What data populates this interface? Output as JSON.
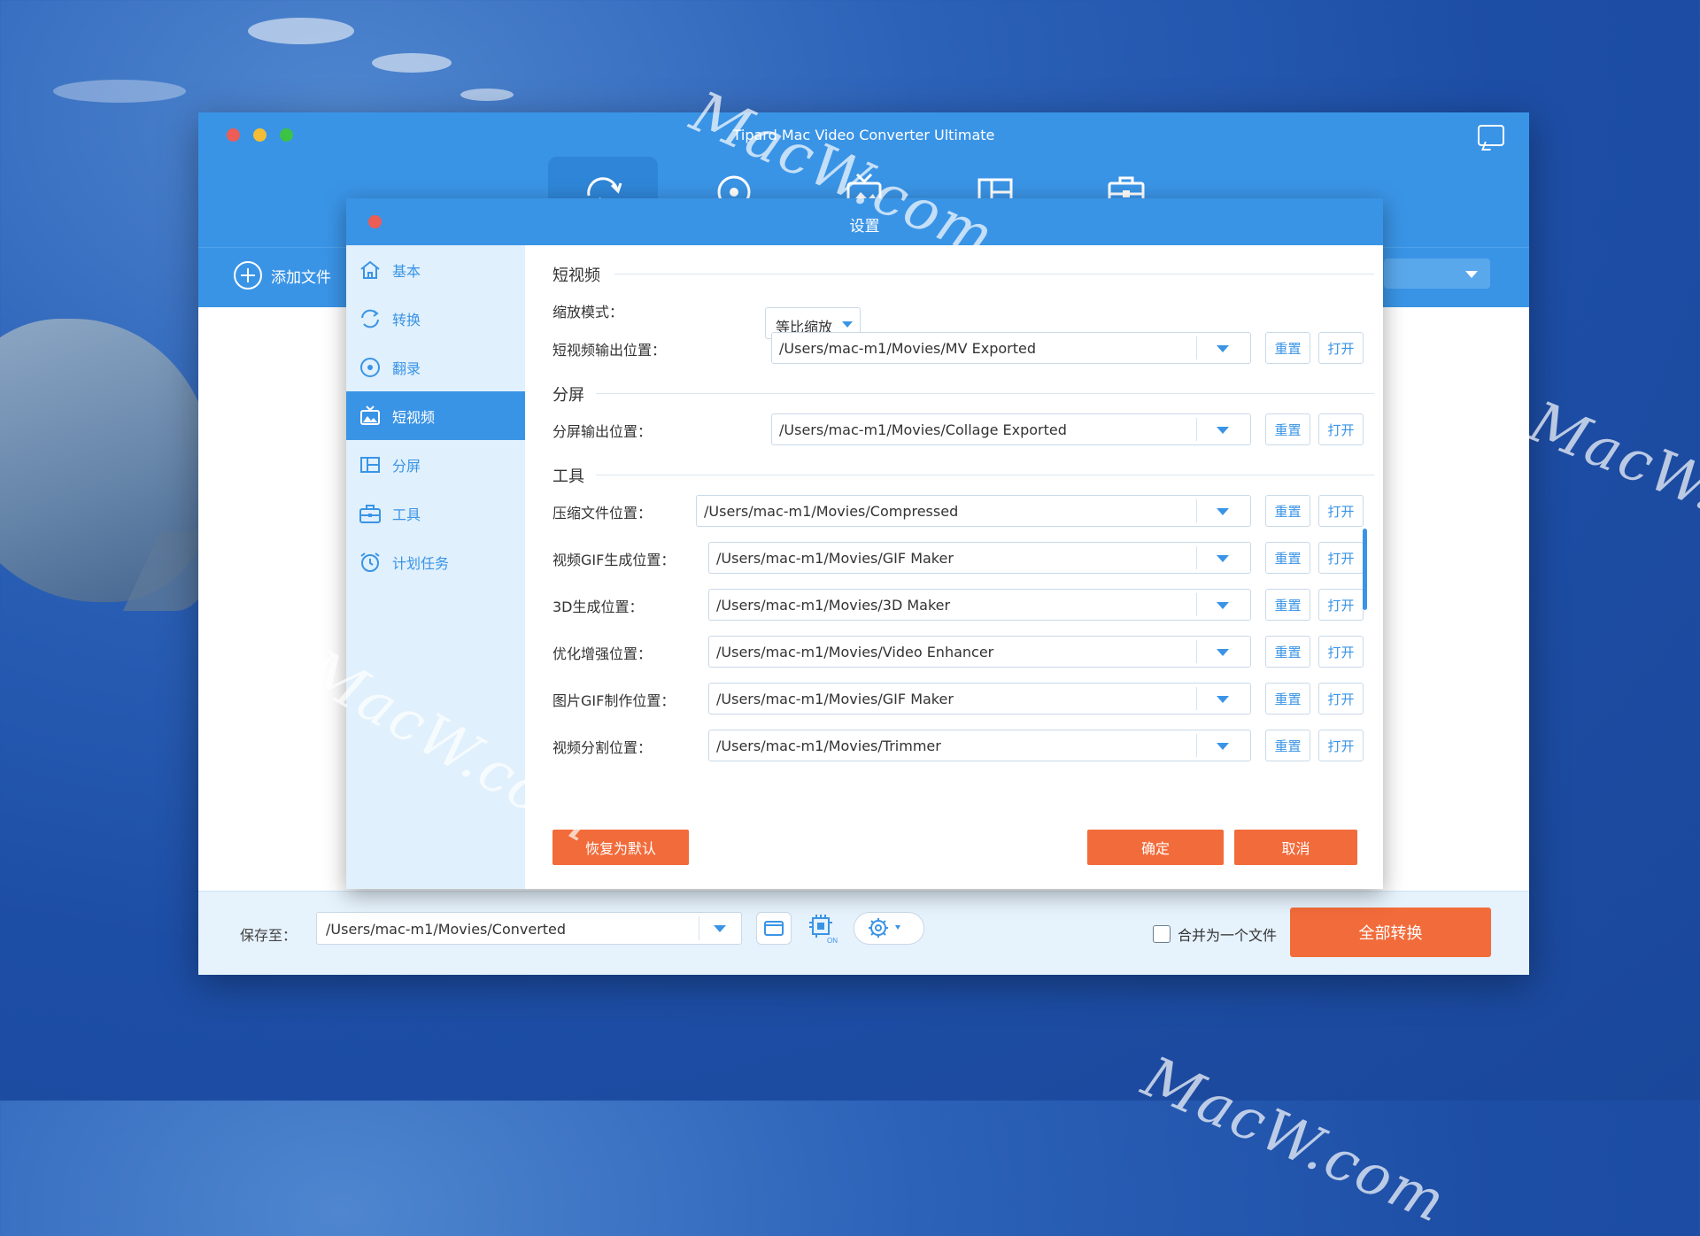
{
  "watermark": "MacW.com",
  "app": {
    "title": "Tipard Mac Video Converter Ultimate",
    "tabs": [
      {
        "name": "convert-tab"
      },
      {
        "name": "ripper-tab"
      },
      {
        "name": "mv-tab"
      },
      {
        "name": "collage-tab"
      },
      {
        "name": "toolbox-tab"
      }
    ],
    "add_file": "添加文件",
    "bottom": {
      "save_label": "保存至：",
      "save_path": "/Users/mac-m1/Movies/Converted",
      "merge_label": "合并为一个文件",
      "convert_all": "全部转换"
    }
  },
  "dialog": {
    "title": "设置",
    "sidebar": [
      {
        "label": "基本",
        "icon": "home-icon"
      },
      {
        "label": "转换",
        "icon": "refresh-icon"
      },
      {
        "label": "翻录",
        "icon": "disc-icon"
      },
      {
        "label": "短视频",
        "icon": "mv-icon"
      },
      {
        "label": "分屏",
        "icon": "collage-icon"
      },
      {
        "label": "工具",
        "icon": "toolbox-icon"
      },
      {
        "label": "计划任务",
        "icon": "alarm-icon"
      }
    ],
    "active_sidebar": "短视频",
    "sections": {
      "short_video": "短视频",
      "collage": "分屏",
      "tools": "工具"
    },
    "scale_mode_label": "缩放模式：",
    "scale_mode_value": "等比缩放",
    "rows": [
      {
        "label": "短视频输出位置：",
        "path": "/Users/mac-m1/Movies/MV Exported"
      },
      {
        "label": "分屏输出位置：",
        "path": "/Users/mac-m1/Movies/Collage Exported"
      },
      {
        "label": "压缩文件位置：",
        "path": "/Users/mac-m1/Movies/Compressed"
      },
      {
        "label": "视频GIF生成位置：",
        "path": "/Users/mac-m1/Movies/GIF Maker"
      },
      {
        "label": "3D生成位置：",
        "path": "/Users/mac-m1/Movies/3D Maker"
      },
      {
        "label": "优化增强位置：",
        "path": "/Users/mac-m1/Movies/Video Enhancer"
      },
      {
        "label": "图片GIF制作位置：",
        "path": "/Users/mac-m1/Movies/GIF Maker"
      },
      {
        "label": "视频分割位置：",
        "path": "/Users/mac-m1/Movies/Trimmer"
      }
    ],
    "reset_label": "重置",
    "open_label": "打开",
    "restore_default": "恢复为默认",
    "ok": "确定",
    "cancel": "取消"
  },
  "colors": {
    "accent": "#3a94e6",
    "action": "#f26b3a",
    "sidebar_bg": "#e0f0fc"
  }
}
